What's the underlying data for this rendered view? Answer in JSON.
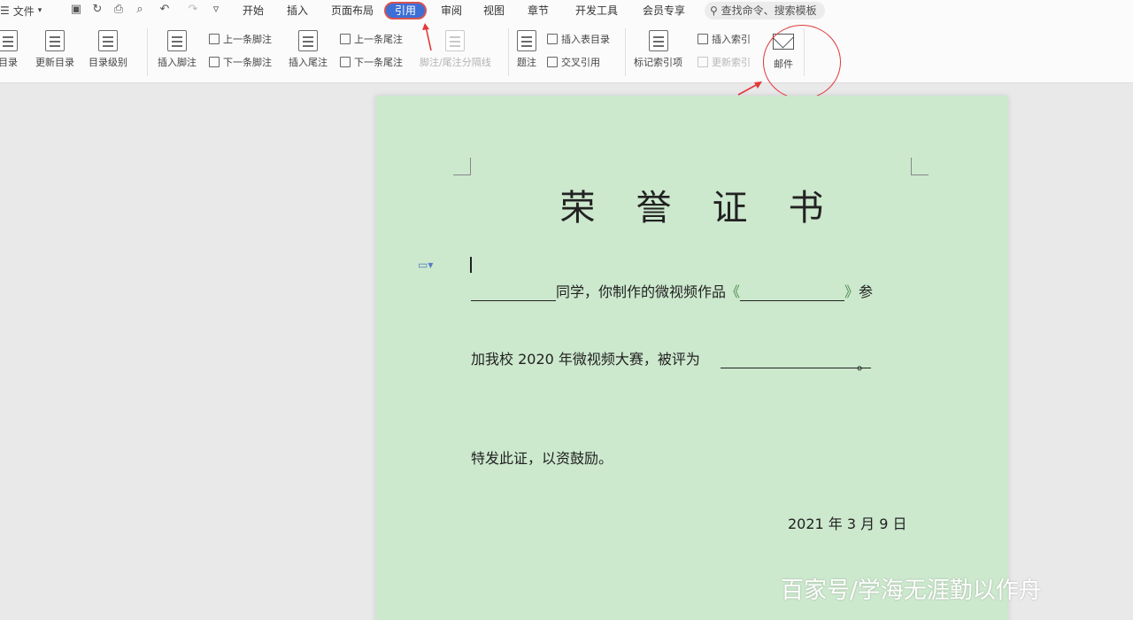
{
  "menubar": {
    "file_label": "文件",
    "tabs": [
      "开始",
      "插入",
      "页面布局",
      "引用",
      "审阅",
      "视图",
      "章节",
      "开发工具",
      "会员专享"
    ],
    "active_tab": "引用",
    "search_placeholder": "查找命令、搜索模板"
  },
  "ribbon": {
    "big_buttons": [
      {
        "label": "目录"
      },
      {
        "label": "更新目录"
      },
      {
        "label": "目录级别"
      },
      {
        "label": "插入脚注"
      },
      {
        "label": "插入尾注"
      },
      {
        "label": "脚注/尾注分隔线"
      },
      {
        "label": "题注"
      },
      {
        "label": "标记索引项"
      },
      {
        "label": "邮件"
      }
    ],
    "small_buttons": [
      {
        "label": "上一条脚注"
      },
      {
        "label": "下一条脚注"
      },
      {
        "label": "上一条尾注"
      },
      {
        "label": "下一条尾注"
      },
      {
        "label": "插入表目录"
      },
      {
        "label": "交叉引用"
      },
      {
        "label": "插入索引"
      },
      {
        "label": "更新索引"
      }
    ]
  },
  "document": {
    "title": "荣誉证书",
    "line1_text": "同学，你制作的微视频作品",
    "line1_open": "《",
    "line1_close": "》",
    "line1_end": "参",
    "line2_text": "加我校 2020 年微视频大赛，被评为",
    "line2_end": "。",
    "line3_text": "特发此证，以资鼓励。",
    "date": "2021 年 3 月 9 日"
  },
  "watermark": "百家号/学海无涯勤以作舟",
  "colors": {
    "accent": "#3d6fd6",
    "annotation_red": "#e03a3a",
    "page_bg": "#cce8cd"
  }
}
